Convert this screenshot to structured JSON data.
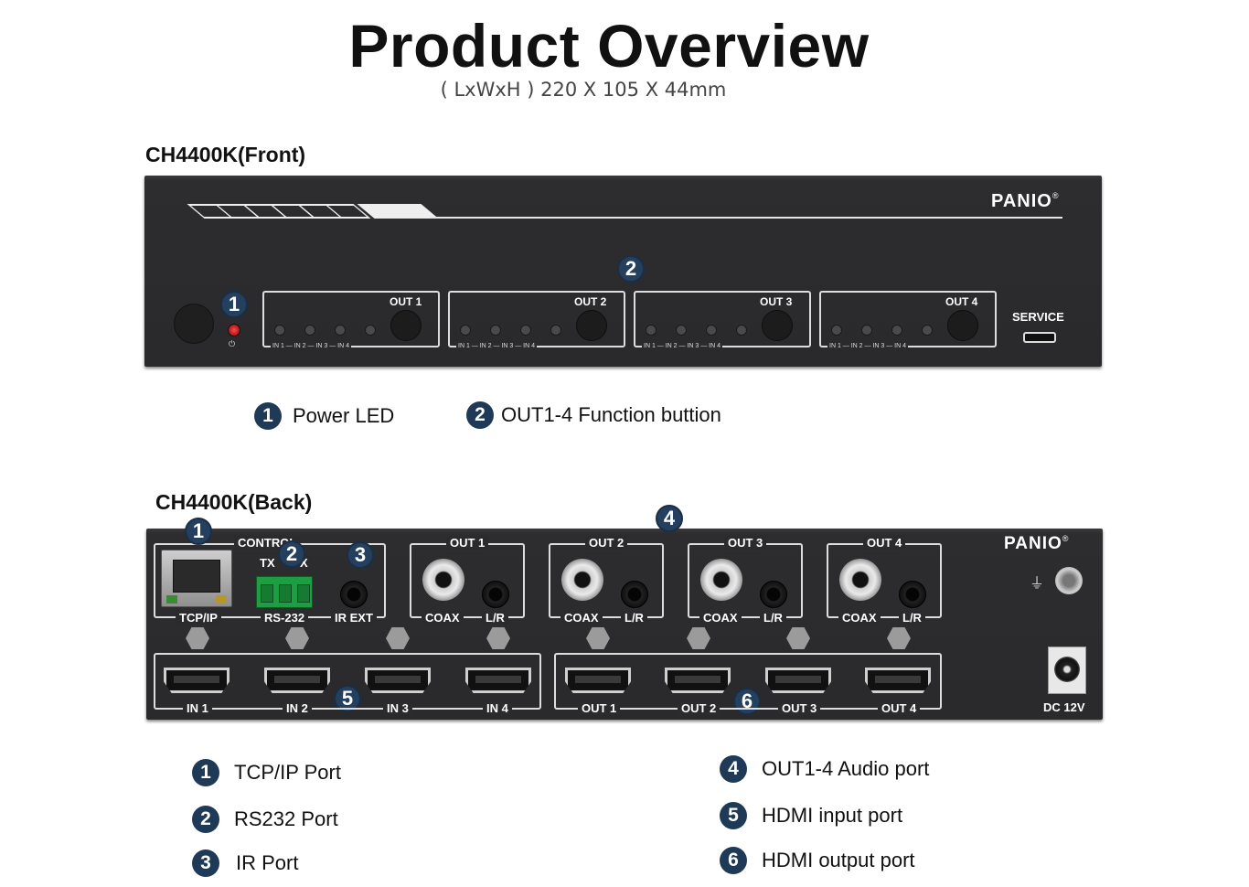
{
  "title": "Product Overview",
  "subtitle": "( LxWxH ) 220 X 105 X 44mm",
  "front": {
    "label": "CH4400K(Front)",
    "logo": "PANIO",
    "logo_mark": "®",
    "power_symbol": "⏻",
    "badges": [
      "1",
      "2"
    ],
    "outputs": [
      "OUT 1",
      "OUT 2",
      "OUT 3",
      "OUT 4"
    ],
    "input_labels": "IN 1 — IN 2 — IN 3 — IN 4",
    "service": "SERVICE"
  },
  "front_legend": [
    {
      "num": "1",
      "text": "Power LED"
    },
    {
      "num": "2",
      "text": "OUT1-4 Function buttion"
    }
  ],
  "back": {
    "label": "CH4400K(Back)",
    "logo": "PANIO",
    "logo_mark": "®",
    "badges": [
      "1",
      "2",
      "3",
      "4",
      "5",
      "6"
    ],
    "control": "CONTROL",
    "tx_rx": "TX",
    "rx": "X",
    "tcp_ip": "TCP/IP",
    "rs232": "RS-232",
    "ir_ext": "IR EXT",
    "outputs": [
      "OUT 1",
      "OUT 2",
      "OUT 3",
      "OUT 4"
    ],
    "coax": "COAX",
    "lr": "L/R",
    "hdmi_in": [
      "IN 1",
      "IN 2",
      "IN 3",
      "IN 4"
    ],
    "hdmi_out": [
      "OUT 1",
      "OUT 2",
      "OUT 3",
      "OUT 4"
    ],
    "ground_symbol": "⏚",
    "dc": "DC 12V"
  },
  "back_legend": [
    {
      "num": "1",
      "text": "TCP/IP Port"
    },
    {
      "num": "2",
      "text": "RS232 Port"
    },
    {
      "num": "3",
      "text": "IR Port"
    },
    {
      "num": "4",
      "text": "OUT1-4 Audio port"
    },
    {
      "num": "5",
      "text": "HDMI input port"
    },
    {
      "num": "6",
      "text": "HDMI output port"
    }
  ]
}
